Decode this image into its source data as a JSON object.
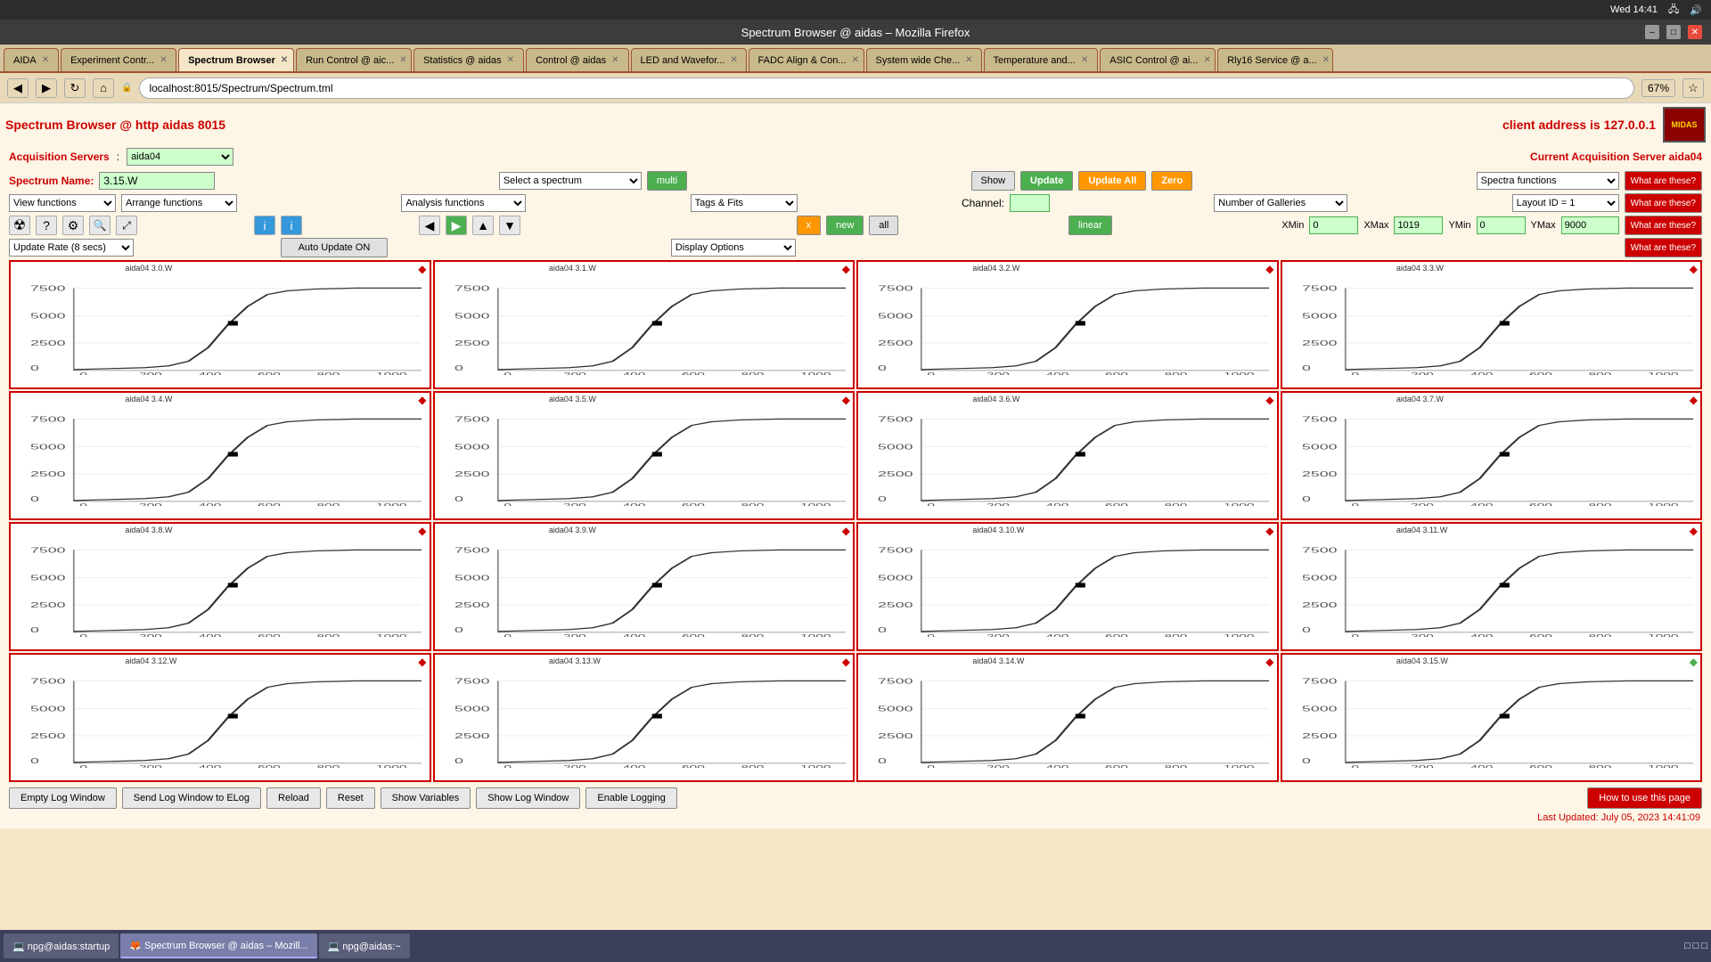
{
  "window": {
    "title": "Spectrum Browser @ aidas – Mozilla Firefox"
  },
  "sysbar": {
    "time": "Wed 14:41",
    "icons": [
      "network-icon",
      "volume-icon",
      "battery-icon"
    ]
  },
  "tabs": [
    {
      "label": "AIDA",
      "active": false
    },
    {
      "label": "Experiment Contr...",
      "active": false
    },
    {
      "label": "Spectrum Browser",
      "active": true
    },
    {
      "label": "Run Control @ aic...",
      "active": false
    },
    {
      "label": "Statistics @ aidas",
      "active": false
    },
    {
      "label": "Control @ aidas",
      "active": false
    },
    {
      "label": "LED and Wavefor...",
      "active": false
    },
    {
      "label": "FADC Align & Con...",
      "active": false
    },
    {
      "label": "System wide Che...",
      "active": false
    },
    {
      "label": "Temperature and...",
      "active": false
    },
    {
      "label": "ASIC Control @ ai...",
      "active": false
    },
    {
      "label": "Rly16 Service @ a...",
      "active": false
    }
  ],
  "nav": {
    "url": "localhost:8015/Spectrum/Spectrum.tml",
    "zoom": "67%"
  },
  "page": {
    "title": "Spectrum Browser @ http aidas 8015",
    "client_address": "client address is 127.0.0.1",
    "acquisition_servers_label": "Acquisition Servers",
    "acquisition_server_value": "aida04",
    "current_server_label": "Current Acquisition Server aida04",
    "spectrum_name_label": "Spectrum Name:",
    "spectrum_name_value": "3.15.W",
    "select_a_spectrum": "Select a spectrum",
    "multi_btn": "multi",
    "show_btn": "Show",
    "update_btn": "Update",
    "update_all_btn": "Update All",
    "zero_btn": "Zero",
    "spectra_functions": "Spectra functions",
    "what_btn1": "What are these?",
    "what_btn2": "What are these?",
    "what_btn3": "What are these?",
    "what_btn4": "What are these?",
    "view_functions": "View functions",
    "arrange_functions": "Arrange functions",
    "analysis_functions": "Analysis functions",
    "tags_fits": "Tags & Fits",
    "channel_label": "Channel:",
    "channel_value": "",
    "number_of_galleries": "Number of Galleries",
    "layout_id": "Layout ID = 1",
    "x_btn": "x",
    "new_btn": "new",
    "all_btn": "all",
    "linear_btn": "linear",
    "xmin_label": "XMin",
    "xmin_value": "0",
    "xmax_label": "XMax",
    "xmax_value": "1019",
    "ymin_label": "YMin",
    "ymin_value": "0",
    "ymax_label": "YMax",
    "ymax_value": "9000",
    "display_options": "Display Options",
    "auto_update": "Auto Update ON",
    "update_rate": "Update Rate (8 secs)",
    "charts": [
      {
        "title": "aida04 3.0.W",
        "green": false
      },
      {
        "title": "aida04 3.1.W",
        "green": false
      },
      {
        "title": "aida04 3.2.W",
        "green": false
      },
      {
        "title": "aida04 3.3.W",
        "green": false
      },
      {
        "title": "aida04 3.4.W",
        "green": false
      },
      {
        "title": "aida04 3.5.W",
        "green": false
      },
      {
        "title": "aida04 3.6.W",
        "green": false
      },
      {
        "title": "aida04 3.7.W",
        "green": false
      },
      {
        "title": "aida04 3.8.W",
        "green": false
      },
      {
        "title": "aida04 3.9.W",
        "green": false
      },
      {
        "title": "aida04 3.10.W",
        "green": false
      },
      {
        "title": "aida04 3.11.W",
        "green": false
      },
      {
        "title": "aida04 3.12.W",
        "green": false
      },
      {
        "title": "aida04 3.13.W",
        "green": false
      },
      {
        "title": "aida04 3.14.W",
        "green": false
      },
      {
        "title": "aida04 3.15.W",
        "green": true
      }
    ],
    "footer": {
      "empty_log": "Empty Log Window",
      "send_log": "Send Log Window to ELog",
      "reload": "Reload",
      "reset": "Reset",
      "show_variables": "Show Variables",
      "show_log": "Show Log Window",
      "enable_logging": "Enable Logging",
      "how_to": "How to use this page",
      "last_updated": "Last Updated: July 05, 2023 14:41:09"
    }
  },
  "taskbar": {
    "items": [
      {
        "label": "npg@aidas:startup",
        "icon": "terminal-icon"
      },
      {
        "label": "Spectrum Browser @ aidas – Mozill...",
        "icon": "firefox-icon",
        "active": true
      },
      {
        "label": "npg@aidas:~",
        "icon": "terminal-icon"
      }
    ]
  }
}
